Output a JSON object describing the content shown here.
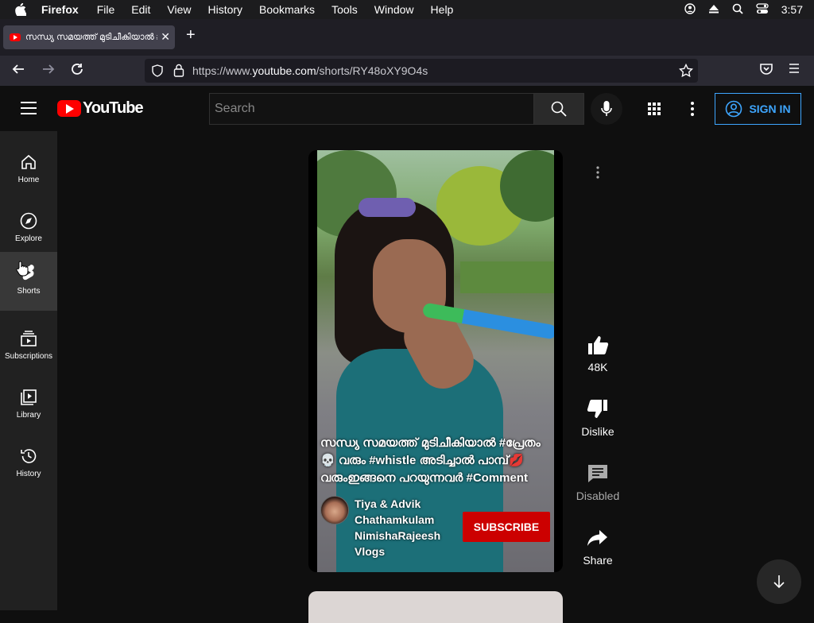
{
  "menubar": {
    "items": [
      "Firefox",
      "File",
      "Edit",
      "View",
      "History",
      "Bookmarks",
      "Tools",
      "Window",
      "Help"
    ],
    "clock": "3:57"
  },
  "browser": {
    "tab_title": "സന്ധ്യ സമയത്ത് മുടിചീകിയാൽ #പ്രേതം",
    "url_prefix": "https://www.",
    "url_domain": "youtube.com",
    "url_path": "/shorts/RY48oXY9O4s"
  },
  "youtube": {
    "logo_text": "YouTube",
    "search_placeholder": "Search",
    "sign_in": "SIGN IN",
    "sidebar": [
      {
        "label": "Home",
        "icon": "home-icon"
      },
      {
        "label": "Explore",
        "icon": "compass-icon"
      },
      {
        "label": "Shorts",
        "icon": "shorts-icon"
      },
      {
        "label": "Subscriptions",
        "icon": "subscriptions-icon"
      },
      {
        "label": "Library",
        "icon": "library-icon"
      },
      {
        "label": "History",
        "icon": "history-icon"
      }
    ],
    "short": {
      "caption_line1": "സന്ധ്യ സമയത്ത് മുടിചീകിയാൽ #പ്രേതം",
      "caption_line2": "💀 വരും #whistle അടിച്ചാൽ പാമ്പ്💋",
      "caption_line3": "വരുംഇങ്ങനെ പറയുന്നവർ #Comment",
      "channel_name": "Tiya & Advik Chathamkulam NimishaRajeesh Vlogs",
      "subscribe_label": "SUBSCRIBE"
    },
    "actions": {
      "like_count": "48K",
      "dislike_label": "Dislike",
      "comments_label": "Disabled",
      "share_label": "Share"
    }
  },
  "colors": {
    "accent_red": "#ff0000",
    "subscribe_red": "#cc0000",
    "signin_blue": "#3ea6ff"
  }
}
